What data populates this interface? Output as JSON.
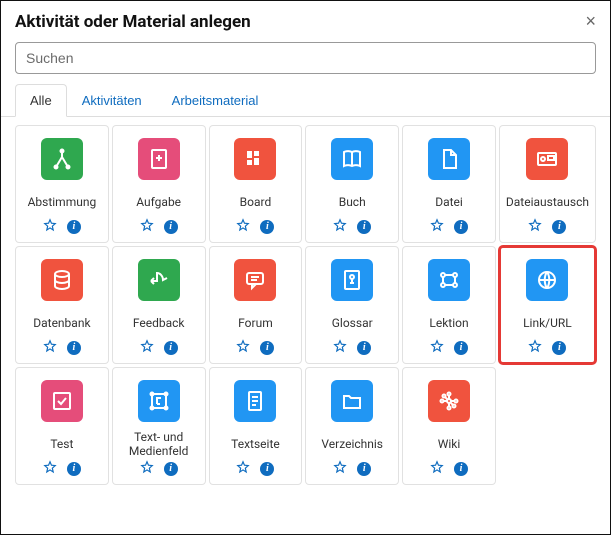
{
  "modal": {
    "title": "Aktivität oder Material anlegen",
    "close": "×"
  },
  "search": {
    "placeholder": "Suchen"
  },
  "tabs": [
    {
      "id": "all",
      "label": "Alle",
      "active": true
    },
    {
      "id": "activities",
      "label": "Aktivitäten",
      "active": false
    },
    {
      "id": "resources",
      "label": "Arbeitsmaterial",
      "active": false
    }
  ],
  "items": [
    {
      "id": "abstimmung",
      "label": "Abstimmung",
      "icon": "choice",
      "color": "c-green",
      "highlighted": false
    },
    {
      "id": "aufgabe",
      "label": "Aufgabe",
      "icon": "assign",
      "color": "c-pink",
      "highlighted": false
    },
    {
      "id": "board",
      "label": "Board",
      "icon": "board",
      "color": "c-orange",
      "highlighted": false
    },
    {
      "id": "buch",
      "label": "Buch",
      "icon": "book",
      "color": "c-blue",
      "highlighted": false
    },
    {
      "id": "datei",
      "label": "Datei",
      "icon": "file",
      "color": "c-blue",
      "highlighted": false
    },
    {
      "id": "dateiaustausch",
      "label": "Dateiaustausch",
      "icon": "exchange",
      "color": "c-orange",
      "highlighted": false
    },
    {
      "id": "datenbank",
      "label": "Datenbank",
      "icon": "db",
      "color": "c-orange",
      "highlighted": false
    },
    {
      "id": "feedback",
      "label": "Feedback",
      "icon": "feedback",
      "color": "c-green",
      "highlighted": false
    },
    {
      "id": "forum",
      "label": "Forum",
      "icon": "forum",
      "color": "c-orange",
      "highlighted": false
    },
    {
      "id": "glossar",
      "label": "Glossar",
      "icon": "glossary",
      "color": "c-blue",
      "highlighted": false
    },
    {
      "id": "lektion",
      "label": "Lektion",
      "icon": "lesson",
      "color": "c-blue",
      "highlighted": false
    },
    {
      "id": "link",
      "label": "Link/URL",
      "icon": "url",
      "color": "c-blue",
      "highlighted": true
    },
    {
      "id": "test",
      "label": "Test",
      "icon": "quiz",
      "color": "c-pink",
      "highlighted": false
    },
    {
      "id": "textmedien",
      "label": "Text- und Medienfeld",
      "icon": "label",
      "color": "c-blue",
      "highlighted": false
    },
    {
      "id": "textseite",
      "label": "Textseite",
      "icon": "page",
      "color": "c-blue",
      "highlighted": false
    },
    {
      "id": "verzeichnis",
      "label": "Verzeichnis",
      "icon": "folder",
      "color": "c-blue",
      "highlighted": false
    },
    {
      "id": "wiki",
      "label": "Wiki",
      "icon": "wiki",
      "color": "c-orange",
      "highlighted": false
    }
  ],
  "icons": {
    "choice": "<svg viewBox='0 0 24 24' fill='none' stroke='currentColor' stroke-width='2'><path d='M12 4 V10 M12 10 L6 20 M12 10 L18 20'/><circle cx='12' cy='4' r='1.5' fill='currentColor'/><circle cx='6' cy='20' r='1.5' fill='currentColor'/><circle cx='18' cy='20' r='1.5' fill='currentColor'/></svg>",
    "assign": "<svg viewBox='0 0 24 24' fill='none' stroke='currentColor' stroke-width='2'><rect x='5' y='3' width='14' height='18' rx='1'/><path d='M12 8 V14 M9 11 H15'/></svg>",
    "board": "<svg viewBox='0 0 24 24' fill='currentColor'><rect x='4' y='4' width='5' height='7'/><rect x='11' y='4' width='5' height='5'/><rect x='4' y='13' width='5' height='5'/><rect x='11' y='11' width='5' height='7'/></svg>",
    "book": "<svg viewBox='0 0 24 24' fill='none' stroke='currentColor' stroke-width='2'><path d='M4 5 C4 5 8 3 12 5 C16 3 20 5 20 5 V19 C20 19 16 17 12 19 C8 17 4 19 4 19 Z M12 5 V19'/></svg>",
    "file": "<svg viewBox='0 0 24 24' fill='none' stroke='currentColor' stroke-width='2'><path d='M7 3 H14 L19 8 V21 H7 Z M14 3 V8 H19'/></svg>",
    "exchange": "<svg viewBox='0 0 24 24' fill='none' stroke='currentColor' stroke-width='2'><rect x='3' y='6' width='18' height='12' rx='1'/><circle cx='8' cy='12' r='2'/><rect x='13' y='9' width='6' height='4'/></svg>",
    "db": "<svg viewBox='0 0 24 24' fill='none' stroke='currentColor' stroke-width='2'><ellipse cx='12' cy='6' rx='7' ry='3'/><path d='M5 6 V18 C5 19.6 8 21 12 21 C16 21 19 19.6 19 18 V6 M5 12 C5 13.6 8 15 12 15 C16 15 19 13.6 19 12'/></svg>",
    "feedback": "<svg viewBox='0 0 24 24' fill='none' stroke='currentColor' stroke-width='2'><path d='M4 13 L10 13 L10 5 C13 5 16 8 16 12 L20 10 M4 13 L7 10 M4 13 L7 16'/></svg>",
    "forum": "<svg viewBox='0 0 24 24' fill='none' stroke='currentColor' stroke-width='2'><rect x='4' y='5' width='16' height='11' rx='2'/><path d='M9 16 L9 20 L13 16 M8 9 H16 M8 12 H14'/></svg>",
    "glossary": "<svg viewBox='0 0 24 24' fill='none' stroke='currentColor' stroke-width='2'><rect x='5' y='3' width='14' height='18' rx='1'/><circle cx='12' cy='9' r='2'/><path d='M12 11 V15 M10 15 H14'/></svg>",
    "lesson": "<svg viewBox='0 0 24 24' fill='none' stroke='currentColor' stroke-width='2'><circle cx='6' cy='7' r='2'/><circle cx='18' cy='7' r='2'/><circle cx='6' cy='17' r='2'/><circle cx='18' cy='17' r='2'/><path d='M8 7 H16 M6 9 V15 M18 9 V15 M8 17 H16'/></svg>",
    "url": "<svg viewBox='0 0 24 24' fill='none' stroke='currentColor' stroke-width='2'><circle cx='12' cy='12' r='8'/><path d='M4 12 H20 M12 4 C9 8 9 16 12 20 M12 4 C15 8 15 16 12 20'/></svg>",
    "quiz": "<svg viewBox='0 0 24 24' fill='none' stroke='currentColor' stroke-width='2'><rect x='4' y='4' width='16' height='16' rx='1'/><path d='M8 12 L11 15 L16 9'/></svg>",
    "label": "<svg viewBox='0 0 24 24' fill='none' stroke='currentColor' stroke-width='2'><rect x='5' y='5' width='14' height='14'/><circle cx='5' cy='5' r='1.5' fill='currentColor'/><circle cx='19' cy='5' r='1.5' fill='currentColor'/><circle cx='5' cy='19' r='1.5' fill='currentColor'/><circle cx='19' cy='19' r='1.5' fill='currentColor'/><path d='M10 15 V9 H14 M10 15 H13'/></svg>",
    "page": "<svg viewBox='0 0 24 24' fill='none' stroke='currentColor' stroke-width='2'><rect x='6' y='3' width='12' height='18' rx='1'/><path d='M9 8 H15 M9 12 H15 M9 16 H13'/></svg>",
    "folder": "<svg viewBox='0 0 24 24' fill='none' stroke='currentColor' stroke-width='2'><path d='M4 7 H9 L11 9 H20 V19 H4 Z'/></svg>",
    "wiki": "<svg viewBox='0 0 24 24' fill='none' stroke='currentColor' stroke-width='2'><circle cx='12' cy='12' r='2'/><circle cx='12' cy='5' r='1.5'/><circle cx='12' cy='19' r='1.5'/><circle cx='5' cy='12' r='1.5'/><circle cx='19' cy='12' r='1.5'/><circle cx='7' cy='7' r='1.5'/><circle cx='17' cy='17' r='1.5'/><path d='M12 7 V10 M12 14 V17 M7 12 H10 M14 12 H17 M8.5 8.5 L10.5 10.5 M13.5 13.5 L15.5 15.5'/></svg>",
    "star": "<svg viewBox='0 0 24 24' fill='none' stroke='currentColor' stroke-width='2'><path d='M12 3 L14.5 9 L21 9.5 L16 14 L17.5 20.5 L12 17 L6.5 20.5 L8 14 L3 9.5 L9.5 9 Z'/></svg>"
  }
}
